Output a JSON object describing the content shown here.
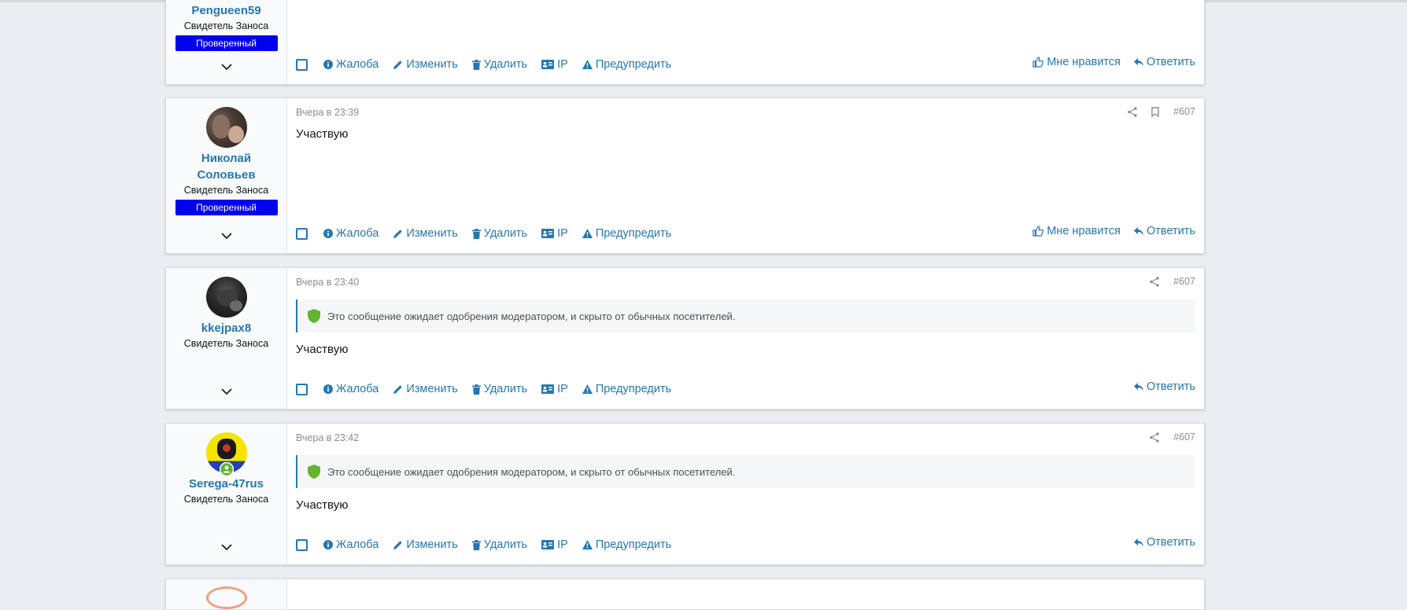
{
  "colors": {
    "link": "#2577b1",
    "badge": "#0000ee",
    "shield": "#63b32e",
    "bg": "#ebeef1"
  },
  "actions": {
    "report": "Жалоба",
    "edit": "Изменить",
    "delete": "Удалить",
    "ip": "IP",
    "warn": "Предупредить",
    "like": "Мне нравится",
    "reply": "Ответить"
  },
  "moderation_notice": "Это сообщение ожидает одобрения модератором, и скрыто от обычных посетителей.",
  "posts": [
    {
      "username": "Pengueen59",
      "user_title": "Свидетель Заноса",
      "badge": "Проверенный",
      "has_like": true
    },
    {
      "username": "Николай Соловьев",
      "user_title": "Свидетель Заноса",
      "badge": "Проверенный",
      "date": "Вчера в 23:39",
      "post_number": "#607",
      "body": "Участвую",
      "has_like": true,
      "has_bookmark": true
    },
    {
      "username": "kkejpax8",
      "user_title": "Свидетель Заноса",
      "date": "Вчера в 23:40",
      "post_number": "#607",
      "body": "Участвую",
      "moderated": true
    },
    {
      "username": "Serega-47rus",
      "user_title": "Свидетель Заноса",
      "date": "Вчера в 23:42",
      "post_number": "#607",
      "body": "Участвую",
      "moderated": true
    }
  ]
}
